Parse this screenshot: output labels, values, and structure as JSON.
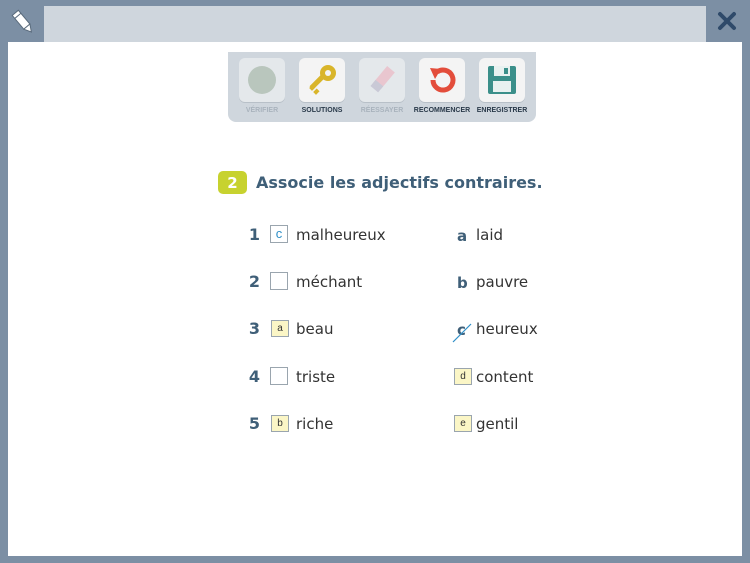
{
  "toolbar": {
    "buttons": [
      {
        "label": "VÉRIFIER",
        "enabled": false,
        "icon": "circle-icon"
      },
      {
        "label": "SOLUTIONS",
        "enabled": true,
        "icon": "key-icon"
      },
      {
        "label": "RÉESSAYER",
        "enabled": false,
        "icon": "eraser-icon"
      },
      {
        "label": "RECOMMENCER",
        "enabled": true,
        "icon": "restart-icon"
      },
      {
        "label": "ENREGISTRER",
        "enabled": true,
        "icon": "save-icon"
      }
    ]
  },
  "exercise": {
    "number": "2",
    "instruction": "Associe les adjectifs contraires.",
    "left": [
      {
        "num": "1",
        "word": "malheureux",
        "answer": "c"
      },
      {
        "num": "2",
        "word": "méchant",
        "answer": ""
      },
      {
        "num": "3",
        "word": "beau",
        "answer": "a"
      },
      {
        "num": "4",
        "word": "triste",
        "answer": ""
      },
      {
        "num": "5",
        "word": "riche",
        "answer": "b"
      }
    ],
    "right": [
      {
        "letter": "a",
        "word": "laid"
      },
      {
        "letter": "b",
        "word": "pauvre"
      },
      {
        "letter": "c",
        "word": "heureux"
      },
      {
        "letter": "d",
        "word": "content"
      },
      {
        "letter": "e",
        "word": "gentil"
      }
    ]
  },
  "colors": {
    "frame": "#7c8fa4",
    "accent_badge": "#c7d22f",
    "heading": "#3f5f78",
    "answer": "#2e8fc8",
    "tag_bg": "#fbf6c6"
  }
}
